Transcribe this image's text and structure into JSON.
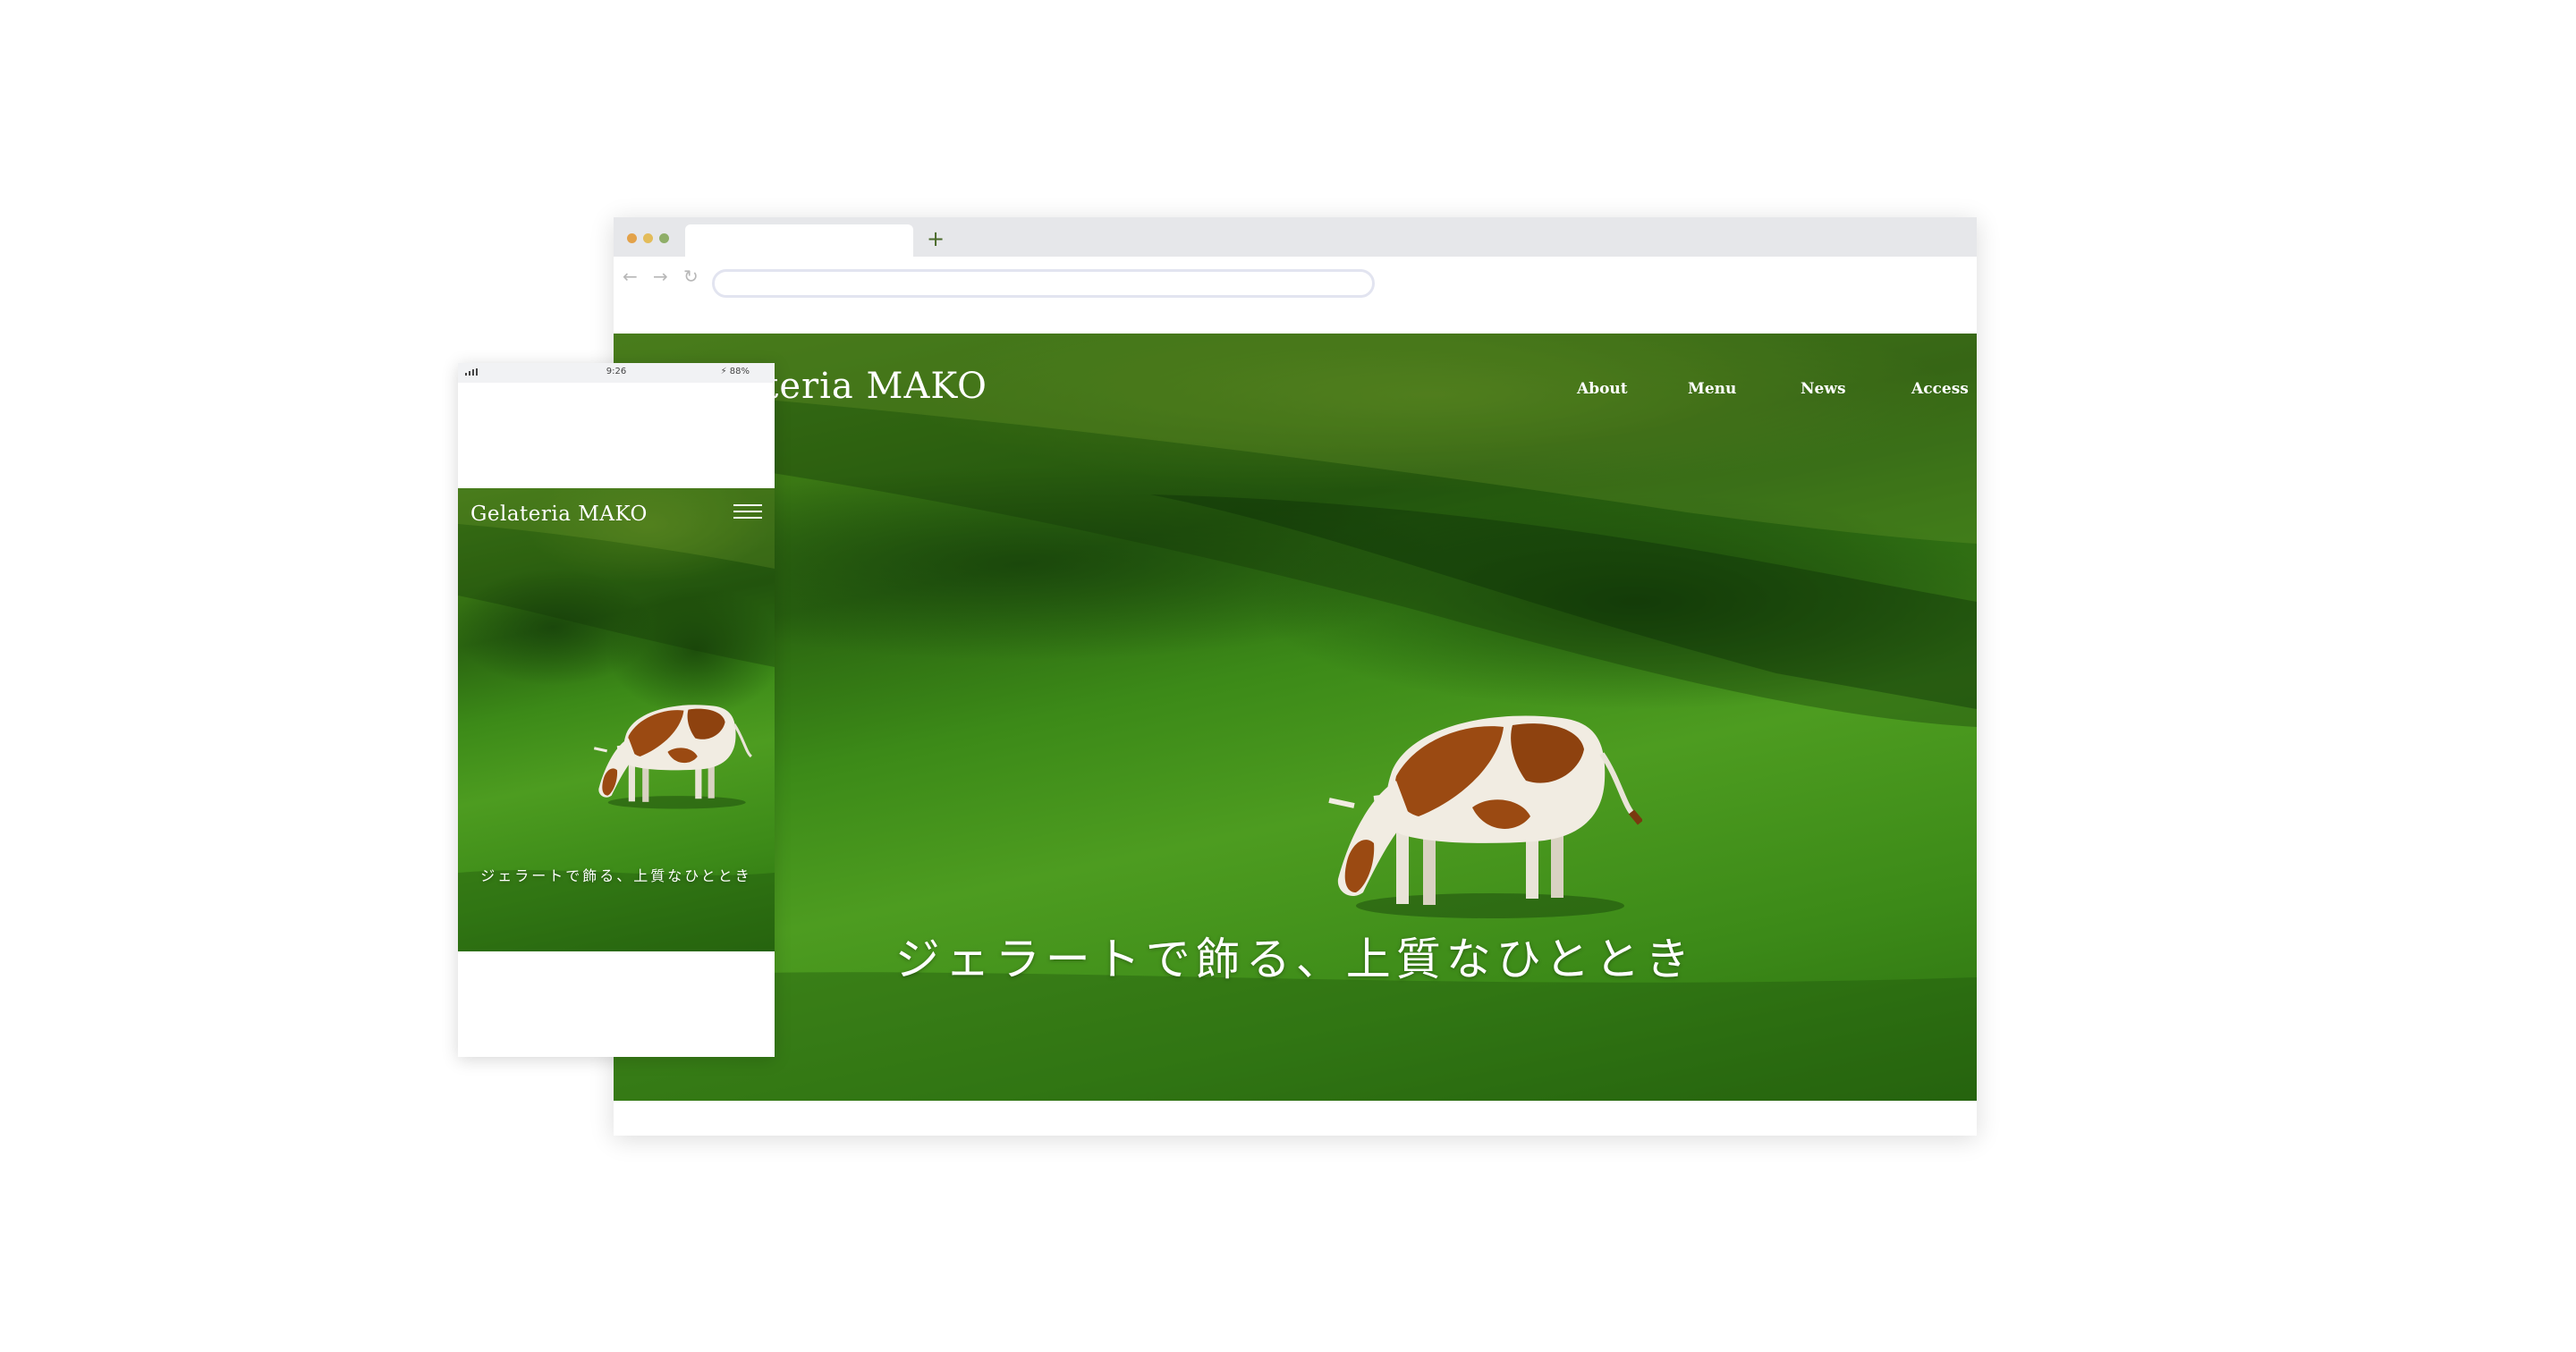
{
  "site": {
    "brand": "Gelateria MAKO",
    "nav": [
      "About",
      "Menu",
      "News",
      "Access"
    ],
    "tagline": "ジェラートで飾る、上質なひととき"
  },
  "browser": {
    "new_tab_label": "+",
    "back_icon": "←",
    "forward_icon": "→",
    "reload_icon": "↻"
  },
  "phone": {
    "time": "9:26",
    "battery": "⚡ 88%"
  },
  "colors": {
    "browser_chrome": "#e6e7ea",
    "grass": "#3c8a18",
    "cow_brown": "#9b4a12"
  }
}
